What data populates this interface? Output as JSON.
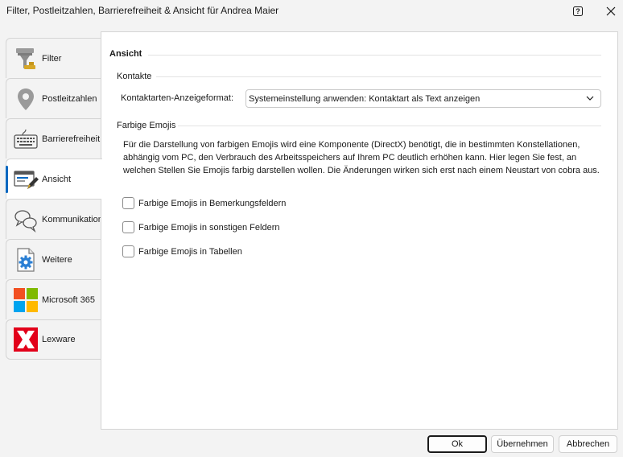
{
  "window": {
    "title": "Filter, Postleitzahlen, Barrierefreiheit & Ansicht für Andrea Maier",
    "help_glyph": "?",
    "close_glyph": "✕"
  },
  "sidebar": {
    "active_index": 3,
    "items": [
      {
        "label": "Filter",
        "icon": "filter-icon"
      },
      {
        "label": "Postleitzahlen",
        "icon": "map-pin-icon"
      },
      {
        "label": "Barrierefreiheit",
        "icon": "keyboard-icon"
      },
      {
        "label": "Ansicht",
        "icon": "view-edit-icon"
      },
      {
        "label": "Kommunikation",
        "icon": "chat-bubbles-icon"
      },
      {
        "label": "Weitere",
        "icon": "gear-icon"
      },
      {
        "label": "Microsoft 365",
        "icon": "microsoft-icon"
      },
      {
        "label": "Lexware",
        "icon": "lexware-icon"
      }
    ]
  },
  "content": {
    "section_title": "Ansicht",
    "contacts": {
      "group_title": "Kontakte",
      "format_label": "Kontaktarten-Anzeigeformat:",
      "format_value": "Systemeinstellung anwenden: Kontaktart als Text anzeigen"
    },
    "emojis": {
      "group_title": "Farbige Emojis",
      "description_lines": [
        "Für die Darstellung von farbigen Emojis wird eine Komponente (DirectX) benötigt, die in bestimmten Konstellationen,",
        "abhängig vom PC, den Verbrauch des Arbeitsspeichers auf Ihrem PC deutlich erhöhen kann. Hier legen Sie fest, an",
        "welchen Stellen Sie Emojis farbig darstellen wollen. Die Änderungen wirken sich erst nach einem Neustart von cobra aus."
      ],
      "checkboxes": [
        {
          "label": "Farbige Emojis in Bemerkungsfeldern",
          "checked": false
        },
        {
          "label": "Farbige Emojis in sonstigen Feldern",
          "checked": false
        },
        {
          "label": "Farbige Emojis in Tabellen",
          "checked": false
        }
      ]
    }
  },
  "buttons": {
    "ok": "Ok",
    "apply": "Übernehmen",
    "cancel": "Abbrechen"
  },
  "colors": {
    "accent": "#0067c0",
    "microsoft": [
      "#f25022",
      "#7fba00",
      "#00a4ef",
      "#ffb900"
    ],
    "lexware": "#e2001a"
  }
}
